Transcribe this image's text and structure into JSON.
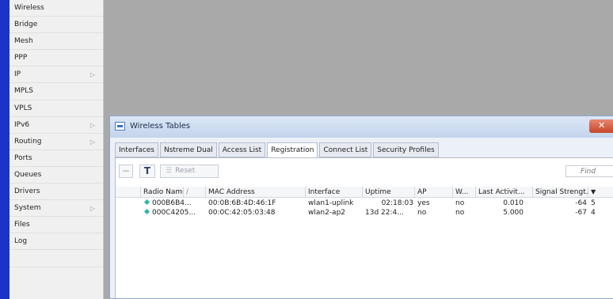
{
  "sidebar": {
    "items": [
      {
        "label": "Wireless",
        "arrow": ""
      },
      {
        "label": "Bridge",
        "arrow": ""
      },
      {
        "label": "Mesh",
        "arrow": ""
      },
      {
        "label": "PPP",
        "arrow": ""
      },
      {
        "label": "IP",
        "arrow": "▷"
      },
      {
        "label": "MPLS",
        "arrow": ""
      },
      {
        "label": "VPLS",
        "arrow": ""
      },
      {
        "label": "IPv6",
        "arrow": "▷"
      },
      {
        "label": "Routing",
        "arrow": "▷"
      },
      {
        "label": "Ports",
        "arrow": ""
      },
      {
        "label": "Queues",
        "arrow": ""
      },
      {
        "label": "Drivers",
        "arrow": ""
      },
      {
        "label": "System",
        "arrow": "▷"
      },
      {
        "label": "Files",
        "arrow": ""
      },
      {
        "label": "Log",
        "arrow": ""
      },
      {
        "label": "",
        "arrow": ""
      }
    ]
  },
  "window": {
    "title": "Wireless Tables",
    "close_glyph": "✕",
    "tabs": [
      "Interfaces",
      "Nstreme Dual",
      "Access List",
      "Registration",
      "Connect List",
      "Security Profiles"
    ],
    "active_tab": 3
  },
  "toolbar": {
    "minus_glyph": "−",
    "filter_glyph": "T",
    "reset_icon": "☰",
    "reset_label": "Reset",
    "find_placeholder": "Find"
  },
  "table": {
    "headers": [
      "Radio Name",
      "/",
      "MAC Address",
      "Interface",
      "Uptime",
      "AP",
      "W...",
      "Last Activit...",
      "Signal Strengt...",
      "▼"
    ],
    "rows": [
      [
        "000B6B4...",
        "00:0B:6B:4D:46:1F",
        "wlan1-uplink",
        "02:18:03",
        "yes",
        "no",
        "0.010",
        "-64",
        "5"
      ],
      [
        "000C4205...",
        "00:0C:42:05:03:48",
        "wlan2-ap2",
        "13d 22:4...",
        "no",
        "no",
        "5.000",
        "-67",
        "4"
      ]
    ]
  }
}
